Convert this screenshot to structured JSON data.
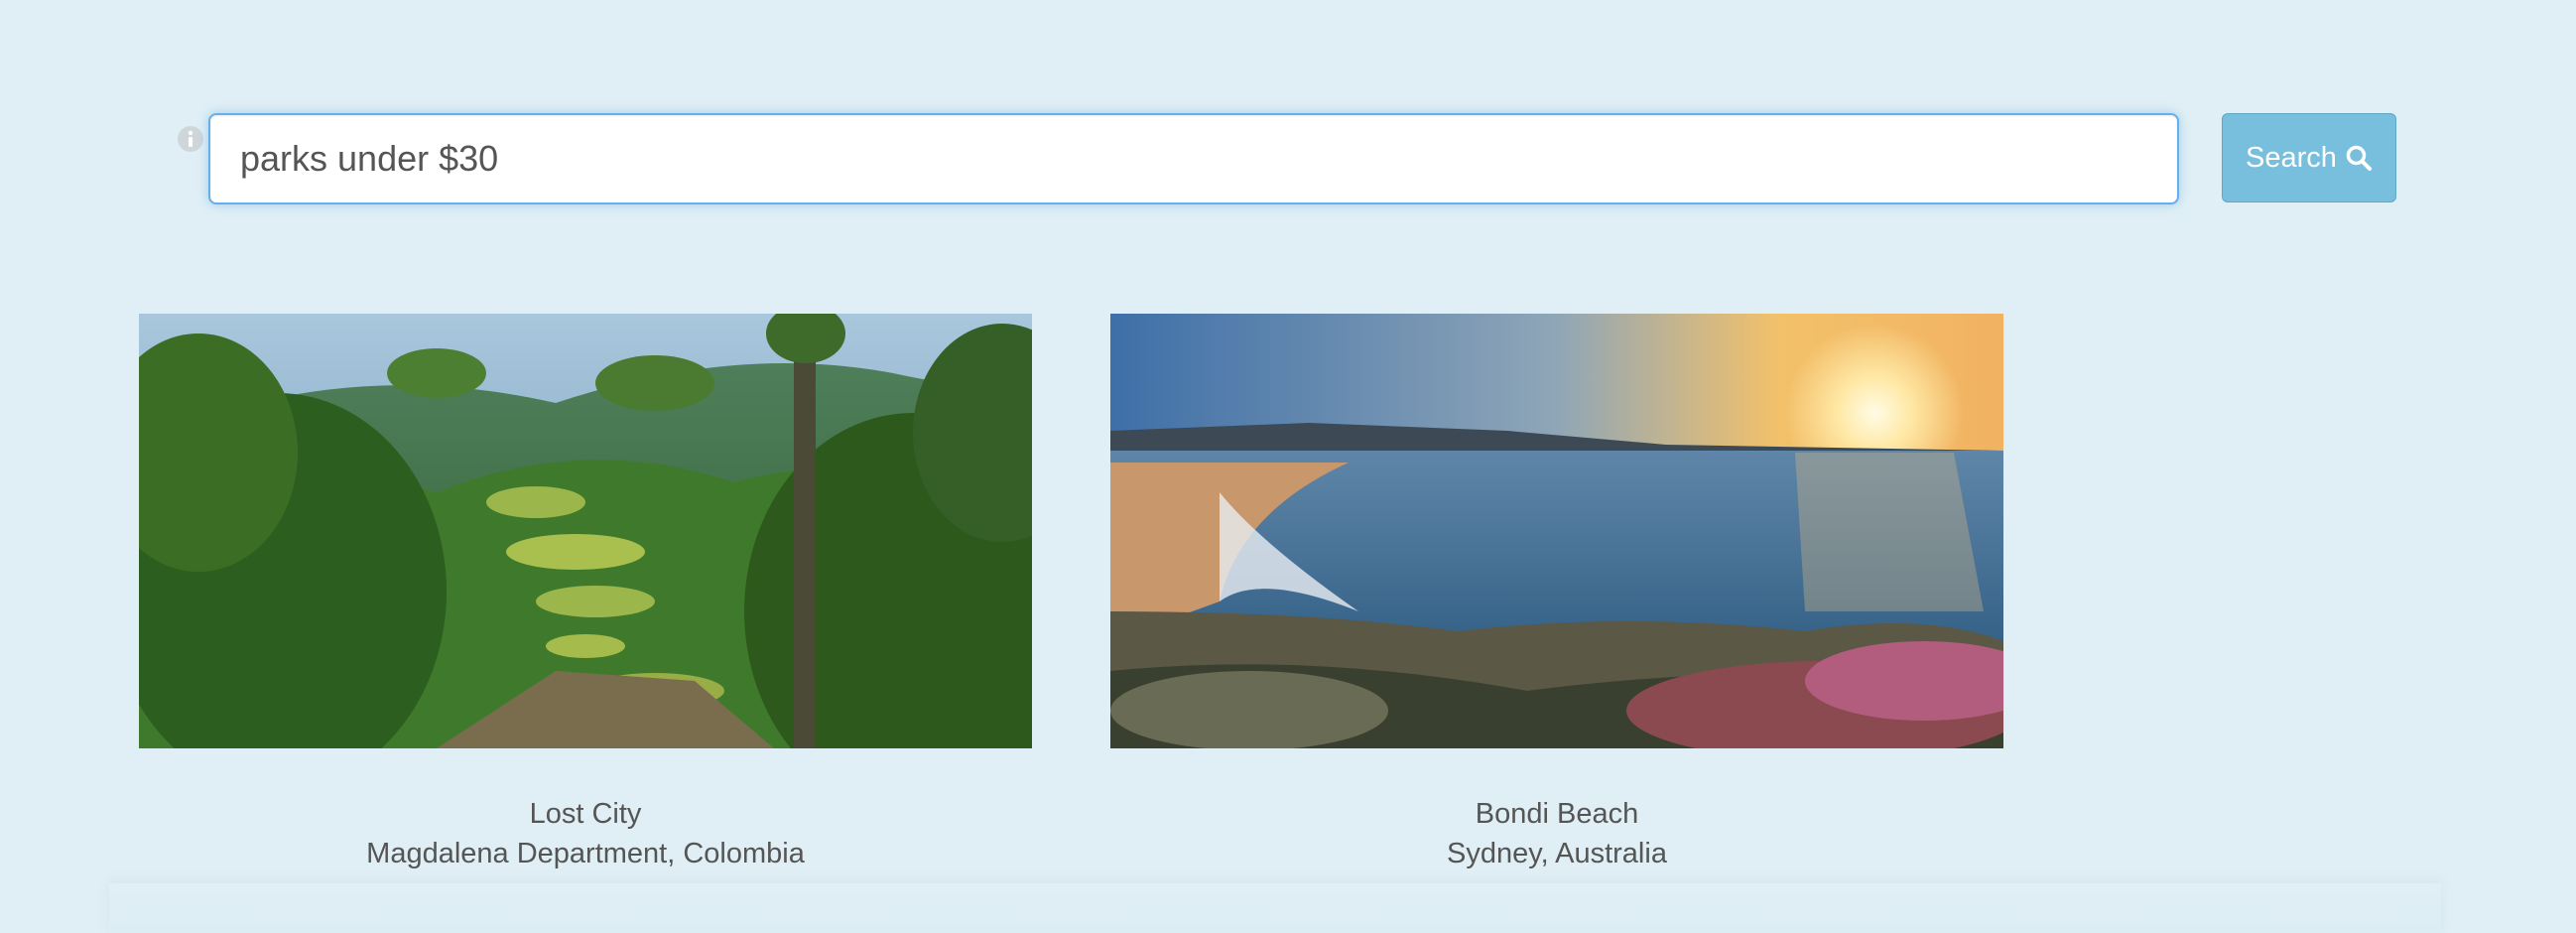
{
  "search": {
    "value": "parks under $30",
    "button_label": "Search"
  },
  "icons": {
    "info": "info-icon",
    "search": "search-icon"
  },
  "colors": {
    "background": "#e0eff5",
    "button": "#78bfde",
    "input_border": "#66afe9",
    "text": "#555555"
  },
  "results": [
    {
      "title": "Lost City",
      "location": "Magdalena Department, Colombia"
    },
    {
      "title": "Bondi Beach",
      "location": "Sydney, Australia"
    }
  ]
}
